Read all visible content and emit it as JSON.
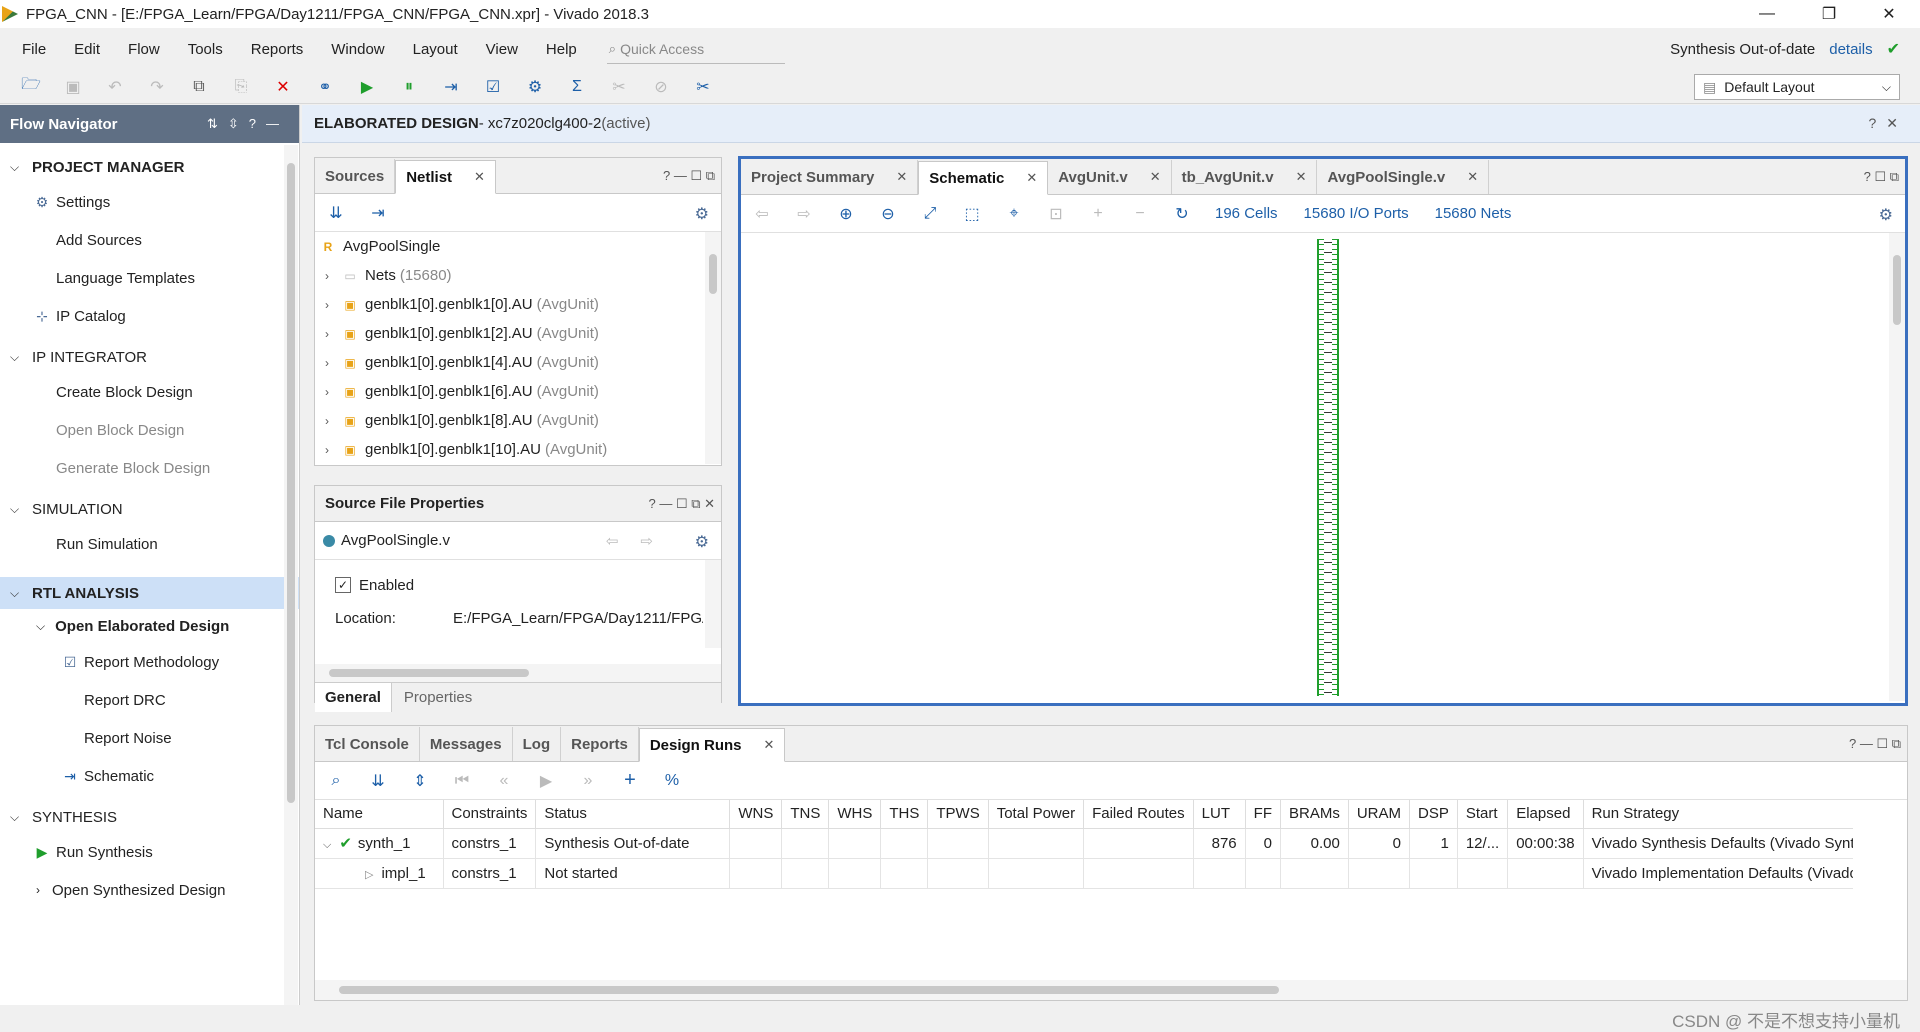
{
  "window": {
    "title": "FPGA_CNN - [E:/FPGA_Learn/FPGA/Day1211/FPGA_CNN/FPGA_CNN.xpr] - Vivado 2018.3",
    "min": "—",
    "max": "❐",
    "close": "✕"
  },
  "menu": [
    "File",
    "Edit",
    "Flow",
    "Tools",
    "Reports",
    "Window",
    "Layout",
    "View",
    "Help"
  ],
  "quick_access": {
    "placeholder": "Quick Access"
  },
  "synth_status": {
    "text": "Synthesis Out-of-date",
    "link": "details"
  },
  "layout_select": {
    "value": "Default Layout"
  },
  "flow_navigator": {
    "title": "Flow Navigator",
    "sections": [
      {
        "label": "PROJECT MANAGER",
        "items": [
          "Settings",
          "Add Sources",
          "Language Templates",
          "IP Catalog"
        ]
      },
      {
        "label": "IP INTEGRATOR",
        "items": [
          "Create Block Design",
          "Open Block Design",
          "Generate Block Design"
        ]
      },
      {
        "label": "SIMULATION",
        "items": [
          "Run Simulation"
        ]
      },
      {
        "label": "RTL ANALYSIS",
        "sub": "Open Elaborated Design",
        "items": [
          "Report Methodology",
          "Report DRC",
          "Report Noise",
          "Schematic"
        ]
      },
      {
        "label": "SYNTHESIS",
        "items": [
          "Run Synthesis",
          "Open Synthesized Design"
        ]
      }
    ]
  },
  "editor_header": {
    "title": "ELABORATED DESIGN",
    "part": " - xc7z020clg400-2",
    "state": " (active)"
  },
  "netlist_panel": {
    "tabs": [
      "Sources",
      "Netlist"
    ],
    "root": "AvgPoolSingle",
    "nets": "Nets",
    "nets_count": "(15680)",
    "rows": [
      {
        "name": "genblk1[0].genblk1[0].AU",
        "type": "(AvgUnit)"
      },
      {
        "name": "genblk1[0].genblk1[2].AU",
        "type": "(AvgUnit)"
      },
      {
        "name": "genblk1[0].genblk1[4].AU",
        "type": "(AvgUnit)"
      },
      {
        "name": "genblk1[0].genblk1[6].AU",
        "type": "(AvgUnit)"
      },
      {
        "name": "genblk1[0].genblk1[8].AU",
        "type": "(AvgUnit)"
      },
      {
        "name": "genblk1[0].genblk1[10].AU",
        "type": "(AvgUnit)"
      }
    ]
  },
  "source_props": {
    "title": "Source File Properties",
    "file": "AvgPoolSingle.v",
    "enabled": "Enabled",
    "location_label": "Location:",
    "location_value": "E:/FPGA_Learn/FPGA/Day1211/FPGA",
    "tabs": [
      "General",
      "Properties"
    ]
  },
  "schematic_panel": {
    "tabs": [
      "Project Summary",
      "Schematic",
      "AvgUnit.v",
      "tb_AvgUnit.v",
      "AvgPoolSingle.v"
    ],
    "cells": "196 Cells",
    "ports": "15680 I/O Ports",
    "nets": "15680 Nets"
  },
  "bottom_panel": {
    "tabs": [
      "Tcl Console",
      "Messages",
      "Log",
      "Reports",
      "Design Runs"
    ],
    "columns": [
      "Name",
      "Constraints",
      "Status",
      "WNS",
      "TNS",
      "WHS",
      "THS",
      "TPWS",
      "Total Power",
      "Failed Routes",
      "LUT",
      "FF",
      "BRAMs",
      "URAM",
      "DSP",
      "Start",
      "Elapsed",
      "Run Strategy"
    ],
    "runs": [
      {
        "name": "synth_1",
        "constraints": "constrs_1",
        "status": "Synthesis Out-of-date",
        "lut": "876",
        "ff": "0",
        "brams": "0.00",
        "uram": "0",
        "dsp": "1",
        "start": "12/...",
        "elapsed": "00:00:38",
        "strategy": "Vivado Synthesis Defaults (Vivado Synth"
      },
      {
        "name": "impl_1",
        "constraints": "constrs_1",
        "status": "Not started",
        "strategy": "Vivado Implementation Defaults (Vivado"
      }
    ]
  },
  "watermark": "CSDN @ 不是不想支持小量机"
}
